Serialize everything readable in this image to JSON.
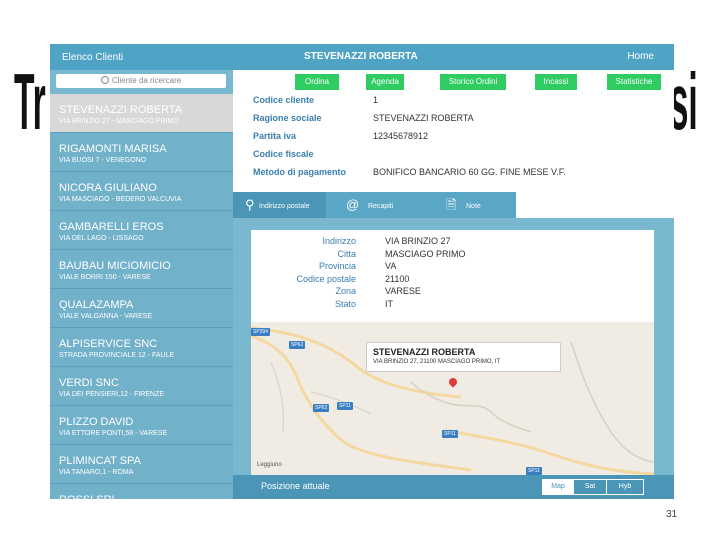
{
  "background_title": {
    "left": "Tr",
    "right": "si"
  },
  "topbar": {
    "left": "Elenco Clienti",
    "title": "STEVENAZZI ROBERTA",
    "right": "Home"
  },
  "search": {
    "placeholder": "Cliente da ricercare"
  },
  "clients": [
    {
      "name": "STEVENAZZI ROBERTA",
      "address": "VIA BRINZIO 27 - MASCIAGO PRIMO",
      "selected": true
    },
    {
      "name": "RIGAMONTI MARISA",
      "address": "VIA BUOSI 7 - VENEGONO"
    },
    {
      "name": "NICORA GIULIANO",
      "address": "VIA MASCIAGO - BEDERO VALCUVIA"
    },
    {
      "name": "GAMBARELLI EROS",
      "address": "VIA DEL LAGO - LISSAGO"
    },
    {
      "name": "BAUBAU MICIOMICIO",
      "address": "VIALE BORRI 150 - VARESE"
    },
    {
      "name": "QUALAZAMPA",
      "address": "VIALE VALGANNA - VARESE"
    },
    {
      "name": "ALPISERVICE SNC",
      "address": "STRADA PROVINCIALE 12 - FAULE"
    },
    {
      "name": "VERDI SNC",
      "address": "VIA DEI PENSIERI,12 - FIRENZE"
    },
    {
      "name": "PLIZZO DAVID",
      "address": "VIA ETTORE PONTI,58 - VARESE"
    },
    {
      "name": "PLIMINCAT SPA",
      "address": "VIA TANARO,1 - ROMA"
    },
    {
      "name": "ROSSI SRL",
      "address": ""
    }
  ],
  "actions": [
    "Ordina",
    "Agenda",
    "Storico Ordini",
    "Incassi",
    "Statistiche"
  ],
  "info": [
    {
      "label": "Codice cliente",
      "value": "1"
    },
    {
      "label": "Ragione sociale",
      "value": "STEVENAZZI ROBERTA"
    },
    {
      "label": "Partita iva",
      "value": "12345678912"
    },
    {
      "label": "Codice fiscale",
      "value": ""
    },
    {
      "label": "Metodo di pagamento",
      "value": "BONIFICO BANCARIO 60 GG. FINE MESE V.F."
    }
  ],
  "tabs": [
    {
      "label": "Indirizzo postale",
      "icon": "pin-icon",
      "active": true
    },
    {
      "label": "Recapiti",
      "icon": "at-icon"
    },
    {
      "label": "Note",
      "icon": "note-icon"
    }
  ],
  "address": [
    {
      "key": "Indirizzo",
      "value": "VIA BRINZIO 27"
    },
    {
      "key": "Citta",
      "value": "MASCIAGO PRIMO"
    },
    {
      "key": "Provincia",
      "value": "VA"
    },
    {
      "key": "Codice postale",
      "value": "21100"
    },
    {
      "key": "Zona",
      "value": "VARESE"
    },
    {
      "key": "Stato",
      "value": "IT"
    }
  ],
  "map": {
    "callout_title": "STEVENAZZI ROBERTA",
    "callout_sub": "VIA BRINZIO 27, 21100 MASCIAGO PRIMO, IT",
    "labels": [
      "SP394",
      "SP62",
      "SP62",
      "SP11",
      "SP11",
      "SP11",
      "Leggiuno"
    ]
  },
  "bottom": {
    "current": "Posizione attuale",
    "modes": [
      "Map",
      "Sat",
      "Hyb"
    ],
    "active_mode": "Map"
  },
  "page_number": "31",
  "colors": {
    "topbar": "#4fa3c4",
    "sidebar": "#7ab8d0",
    "action_button": "#2fcc62",
    "label": "#3a7fb0"
  }
}
